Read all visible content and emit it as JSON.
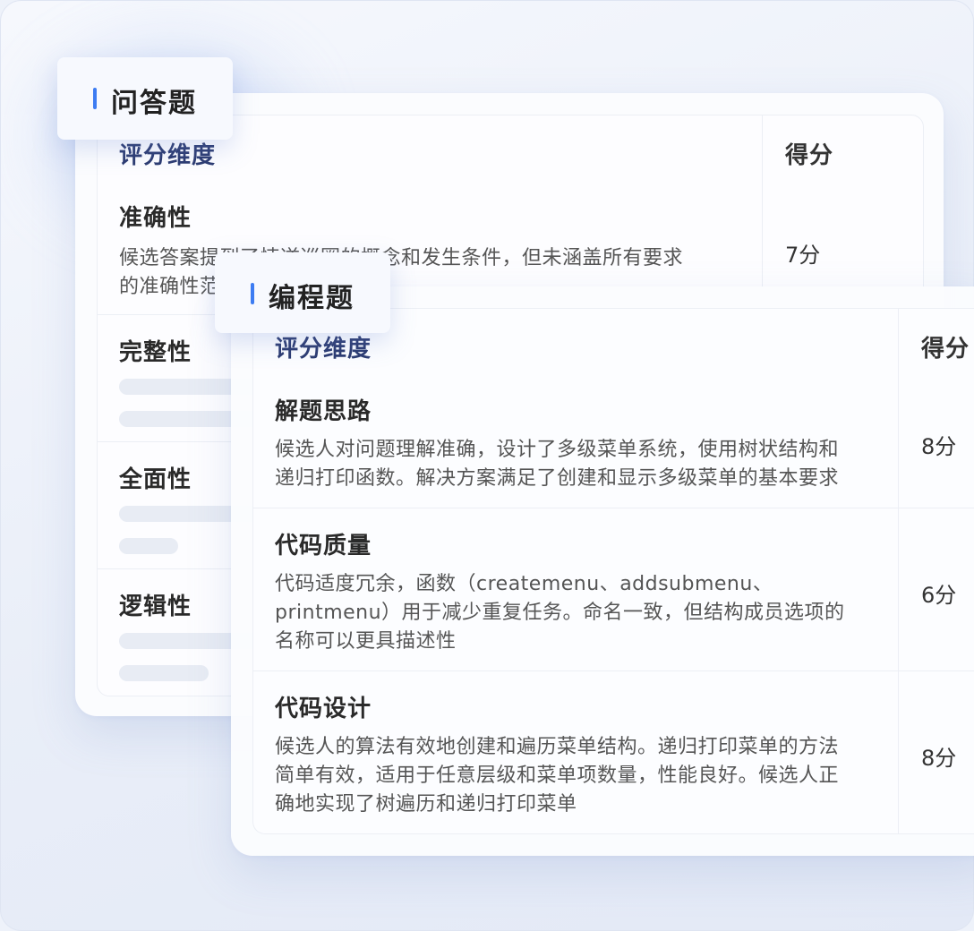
{
  "qa_card": {
    "tab_label": "问答题",
    "header_dimension": "评分维度",
    "header_score": "得分",
    "rows": [
      {
        "title": "准确性",
        "desc_line1": "候选答案提到了悖逆巡圈的概念和发生条件，但未涵盖所有要求",
        "desc_line2": "的准确性范",
        "score": "7分"
      },
      {
        "title": "完整性"
      },
      {
        "title": "全面性"
      },
      {
        "title": "逻辑性"
      }
    ]
  },
  "code_card": {
    "tab_label": "编程题",
    "header_dimension": "评分维度",
    "header_score": "得分",
    "rows": [
      {
        "title": "解题思路",
        "desc": [
          "候选人对问题理解准确，设计了多级菜单系统，使用树状结构和",
          "递归打印函数。解决方案满足了创建和显示多级菜单的基本要求"
        ],
        "score": "8分"
      },
      {
        "title": "代码质量",
        "desc": [
          "代码适度冗余，函数（createmenu、addsubmenu、",
          "printmenu）用于减少重复任务。命名一致，但结构成员选项的",
          "名称可以更具描述性"
        ],
        "score": "6分"
      },
      {
        "title": "代码设计",
        "desc": [
          "候选人的算法有效地创建和遍历菜单结构。递归打印菜单的方法",
          "简单有效，适用于任意层级和菜单项数量，性能良好。候选人正",
          "确地实现了树遍历和递归打印菜单"
        ],
        "score": "8分"
      }
    ]
  },
  "colors": {
    "accent": "#3d7cf2",
    "header_text": "#2b3a70"
  }
}
